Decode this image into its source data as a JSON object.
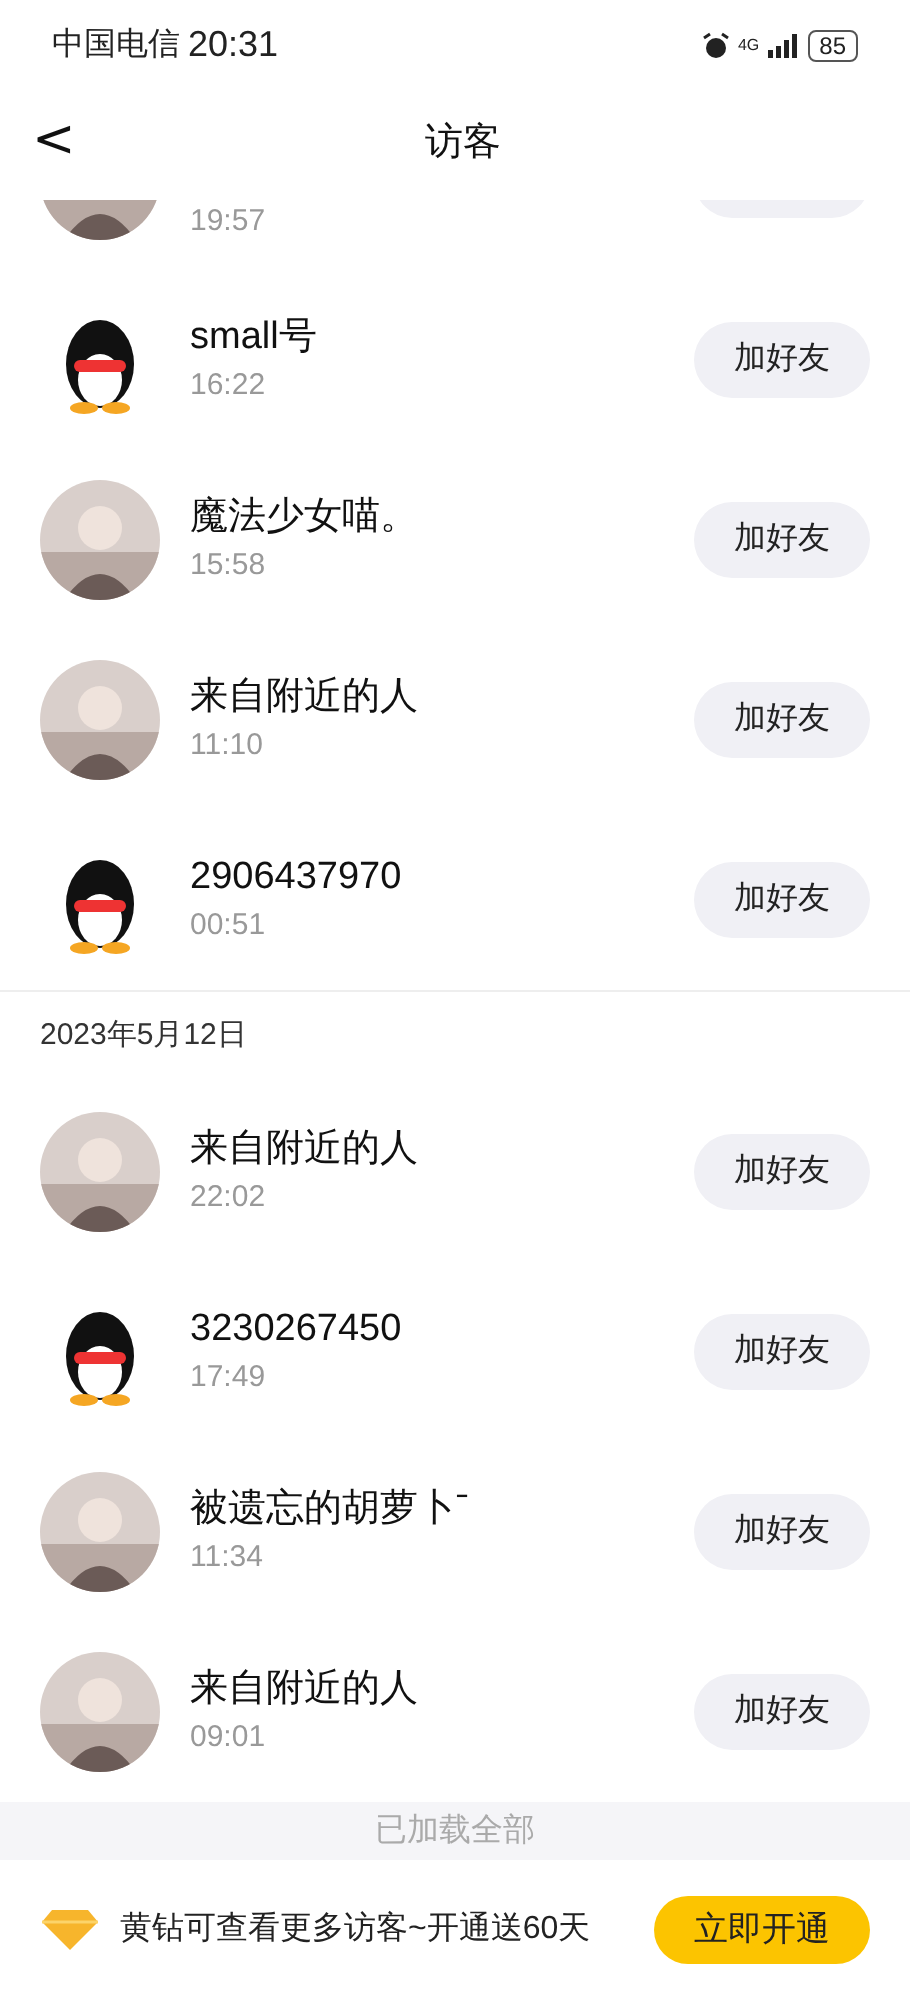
{
  "status_bar": {
    "carrier": "中国电信",
    "time": "20:31",
    "network": "4G",
    "battery": "85"
  },
  "header": {
    "back": "<",
    "title": "访客"
  },
  "sections": [
    {
      "rows": [
        {
          "time": "19:57"
        },
        {
          "kind": "penguin",
          "name": "small号",
          "time": "16:22",
          "button": "加好友"
        },
        {
          "name": "魔法少女喵。",
          "time": "15:58",
          "button": "加好友"
        },
        {
          "name": "来自附近的人",
          "time": "11:10",
          "button": "加好友"
        },
        {
          "kind": "penguin",
          "name": "2906437970",
          "time": "00:51",
          "button": "加好友"
        }
      ]
    },
    {
      "date": "2023年5月12日",
      "rows": [
        {
          "name": "来自附近的人",
          "time": "22:02",
          "button": "加好友"
        },
        {
          "kind": "penguin",
          "name": "3230267450",
          "time": "17:49",
          "button": "加好友"
        },
        {
          "name": "被遗忘的胡萝卜ˉ",
          "time": "11:34",
          "button": "加好友"
        },
        {
          "name": "来自附近的人",
          "time": "09:01",
          "button": "加好友"
        }
      ]
    }
  ],
  "footer": "已加载全部",
  "banner": {
    "text": "黄钻可查看更多访客~开通送60天",
    "button": "立即开通"
  }
}
